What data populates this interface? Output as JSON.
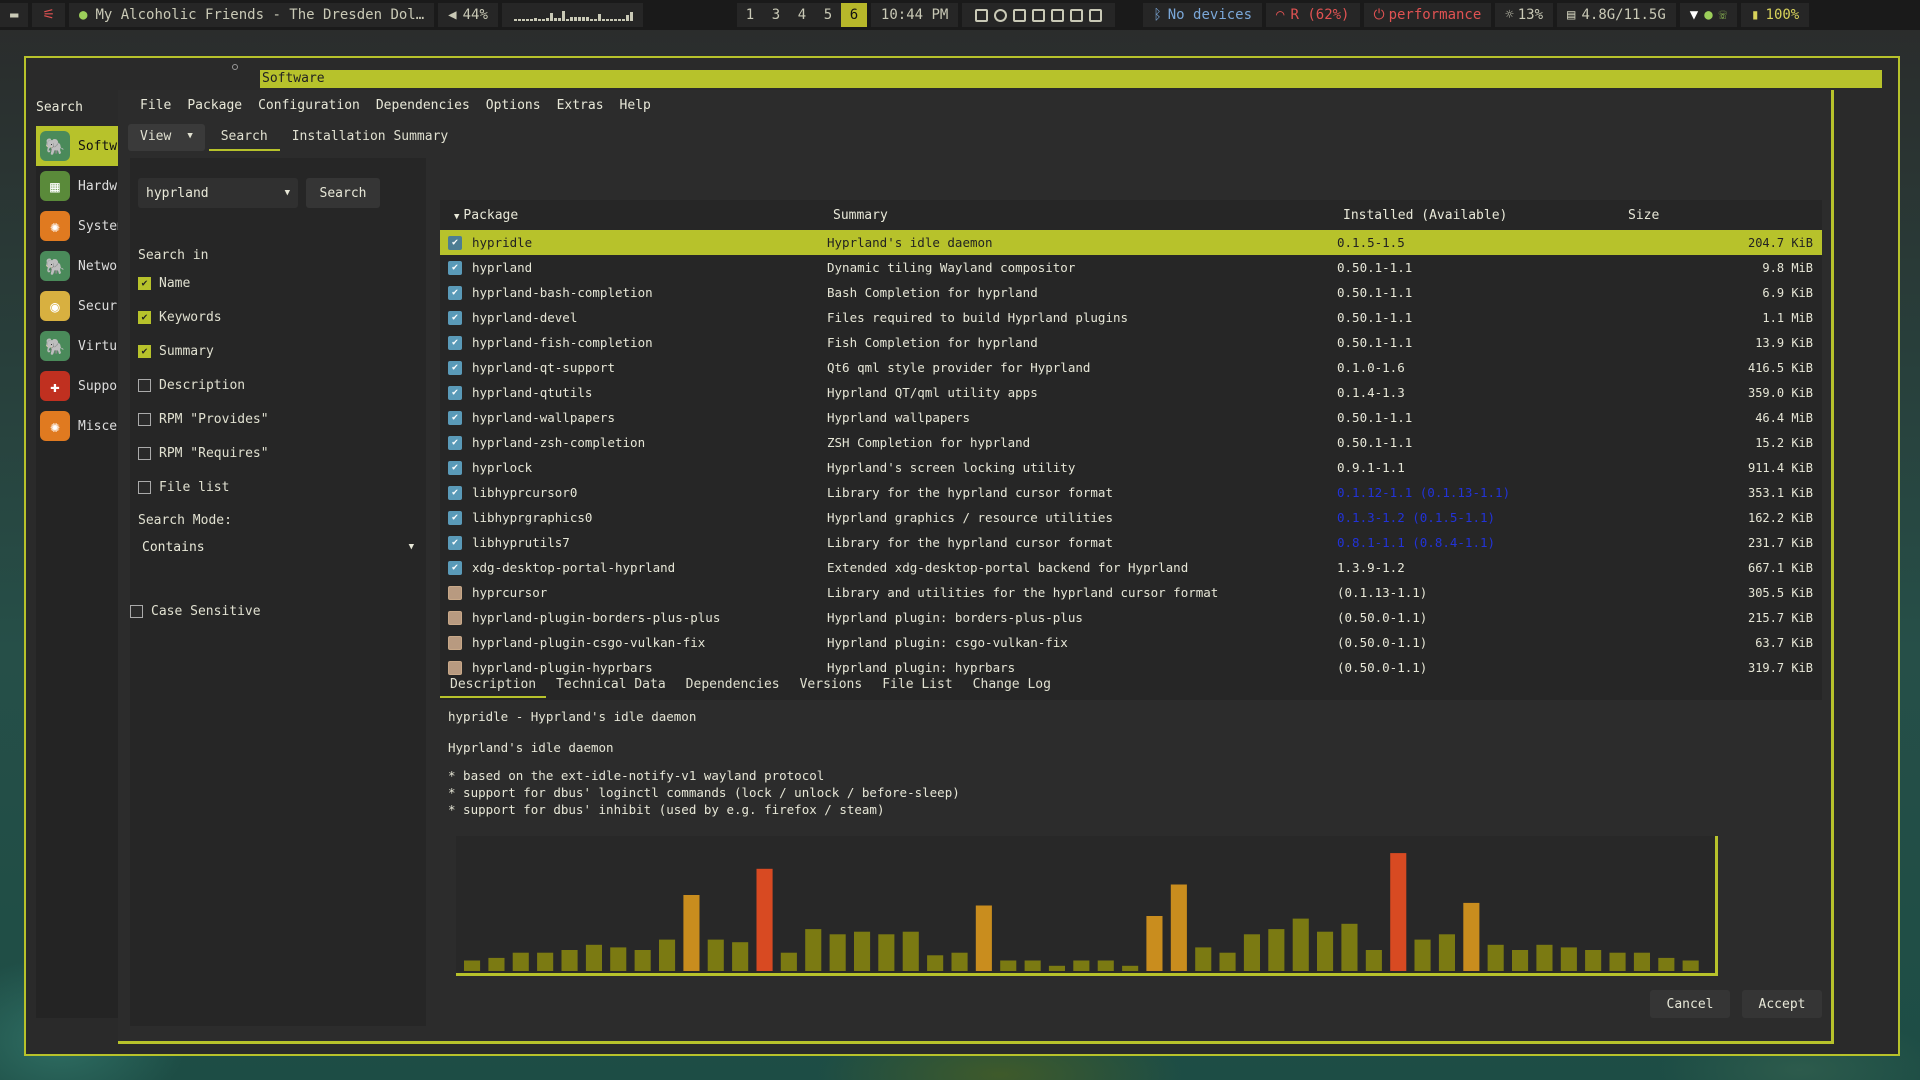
{
  "topbar": {
    "now_playing": "My Alcoholic Friends - The Dresden Dol…",
    "volume": "44%",
    "workspaces": [
      "1",
      "3",
      "4",
      "5",
      "6"
    ],
    "active_workspace": "6",
    "clock": "10:44 PM",
    "bluetooth": "No devices",
    "wifi_signal": "R (62%)",
    "power_profile": "performance",
    "cpu": "13%",
    "memory": "4.8G/11.5G",
    "battery": "100%"
  },
  "outer_window": {
    "left_title": "Search",
    "categories": [
      "Software",
      "Hardware",
      "System",
      "Network",
      "Security",
      "Virtualization",
      "Support",
      "Miscellaneous"
    ],
    "active_category": "Software"
  },
  "dialog": {
    "title": "Software",
    "menu": [
      "File",
      "Package",
      "Configuration",
      "Dependencies",
      "Options",
      "Extras",
      "Help"
    ],
    "view_label": "View",
    "tabs": [
      "Search",
      "Installation Summary"
    ],
    "active_tab": "Search"
  },
  "search": {
    "query": "hyprland",
    "button": "Search",
    "search_in_label": "Search in",
    "options": [
      {
        "label": "Name",
        "checked": true
      },
      {
        "label": "Keywords",
        "checked": true
      },
      {
        "label": "Summary",
        "checked": true
      },
      {
        "label": "Description",
        "checked": false
      },
      {
        "label": "RPM \"Provides\"",
        "checked": false
      },
      {
        "label": "RPM \"Requires\"",
        "checked": false
      },
      {
        "label": "File list",
        "checked": false
      }
    ],
    "mode_label": "Search Mode:",
    "mode_value": "Contains",
    "case_sensitive_label": "Case Sensitive",
    "case_sensitive": false
  },
  "table": {
    "headers": [
      "Package",
      "Summary",
      "Installed (Available)",
      "Size"
    ],
    "rows": [
      {
        "installed": true,
        "name": "hypridle",
        "summary": "Hyprland's idle daemon",
        "version": "0.1.5-1.5",
        "size": "204.7 KiB",
        "selected": true
      },
      {
        "installed": true,
        "name": "hyprland",
        "summary": "Dynamic tiling Wayland compositor",
        "version": "0.50.1-1.1",
        "size": "9.8 MiB"
      },
      {
        "installed": true,
        "name": "hyprland-bash-completion",
        "summary": "Bash Completion for hyprland",
        "version": "0.50.1-1.1",
        "size": "6.9 KiB"
      },
      {
        "installed": true,
        "name": "hyprland-devel",
        "summary": "Files required to build Hyprland plugins",
        "version": "0.50.1-1.1",
        "size": "1.1 MiB"
      },
      {
        "installed": true,
        "name": "hyprland-fish-completion",
        "summary": "Fish Completion for hyprland",
        "version": "0.50.1-1.1",
        "size": "13.9 KiB"
      },
      {
        "installed": true,
        "name": "hyprland-qt-support",
        "summary": "Qt6 qml style provider for Hyprland",
        "version": "0.1.0-1.6",
        "size": "416.5 KiB"
      },
      {
        "installed": true,
        "name": "hyprland-qtutils",
        "summary": "Hyprland QT/qml utility apps",
        "version": "0.1.4-1.3",
        "size": "359.0 KiB"
      },
      {
        "installed": true,
        "name": "hyprland-wallpapers",
        "summary": "Hyprland wallpapers",
        "version": "0.50.1-1.1",
        "size": "46.4 MiB"
      },
      {
        "installed": true,
        "name": "hyprland-zsh-completion",
        "summary": "ZSH Completion for hyprland",
        "version": "0.50.1-1.1",
        "size": "15.2 KiB"
      },
      {
        "installed": true,
        "name": "hyprlock",
        "summary": "Hyprland's screen locking utility",
        "version": "0.9.1-1.1",
        "size": "911.4 KiB"
      },
      {
        "installed": true,
        "name": "libhyprcursor0",
        "summary": "Library for the hyprland cursor format",
        "version": "0.1.12-1.1 (0.1.13-1.1)",
        "size": "353.1 KiB",
        "upgrade": true
      },
      {
        "installed": true,
        "name": "libhyprgraphics0",
        "summary": "Hyprland graphics / resource utilities",
        "version": "0.1.3-1.2 (0.1.5-1.1)",
        "size": "162.2 KiB",
        "upgrade": true
      },
      {
        "installed": true,
        "name": "libhyprutils7",
        "summary": "Library for the hyprland cursor format",
        "version": "0.8.1-1.1 (0.8.4-1.1)",
        "size": "231.7 KiB",
        "upgrade": true
      },
      {
        "installed": true,
        "name": "xdg-desktop-portal-hyprland",
        "summary": "Extended xdg-desktop-portal backend for Hyprland",
        "version": "1.3.9-1.2",
        "size": "667.1 KiB"
      },
      {
        "installed": false,
        "name": "hyprcursor",
        "summary": "Library and utilities for the hyprland cursor format",
        "version": "(0.1.13-1.1)",
        "size": "305.5 KiB"
      },
      {
        "installed": false,
        "name": "hyprland-plugin-borders-plus-plus",
        "summary": "Hyprland plugin: borders-plus-plus",
        "version": "(0.50.0-1.1)",
        "size": "215.7 KiB"
      },
      {
        "installed": false,
        "name": "hyprland-plugin-csgo-vulkan-fix",
        "summary": "Hyprland plugin: csgo-vulkan-fix",
        "version": "(0.50.0-1.1)",
        "size": "63.7 KiB"
      },
      {
        "installed": false,
        "name": "hyprland-plugin-hyprbars",
        "summary": "Hyprland plugin: hyprbars",
        "version": "(0.50.0-1.1)",
        "size": "319.7 KiB"
      }
    ]
  },
  "detail_tabs": [
    "Description",
    "Technical Data",
    "Dependencies",
    "Versions",
    "File List",
    "Change Log"
  ],
  "detail_active": "Description",
  "description": {
    "heading": "hypridle - Hyprland's idle daemon",
    "summary": "Hyprland's idle daemon",
    "bullets": [
      "* based on the ext-idle-notify-v1 wayland protocol",
      "* support for dbus' loginctl commands (lock / unlock / before-sleep)",
      "* support for dbus' inhibit (used by e.g. firefox / steam)"
    ]
  },
  "visualizer": {
    "levels": [
      8,
      10,
      14,
      14,
      16,
      20,
      18,
      16,
      24,
      58,
      24,
      22,
      78,
      14,
      32,
      28,
      30,
      28,
      30,
      12,
      14,
      50,
      8,
      8,
      4,
      8,
      8,
      4,
      42,
      66,
      18,
      14,
      28,
      32,
      40,
      30,
      36,
      16,
      90,
      24,
      28,
      52,
      20,
      16,
      20,
      18,
      16,
      14,
      14,
      10,
      8
    ],
    "colors": {
      "low": "#7b7a12",
      "mid": "#c98d1e",
      "high": "#d84a22"
    }
  },
  "footer": {
    "cancel": "Cancel",
    "accept": "Accept"
  },
  "colors": {
    "accent": "#b7c22b",
    "upgrade": "#2233d8"
  }
}
